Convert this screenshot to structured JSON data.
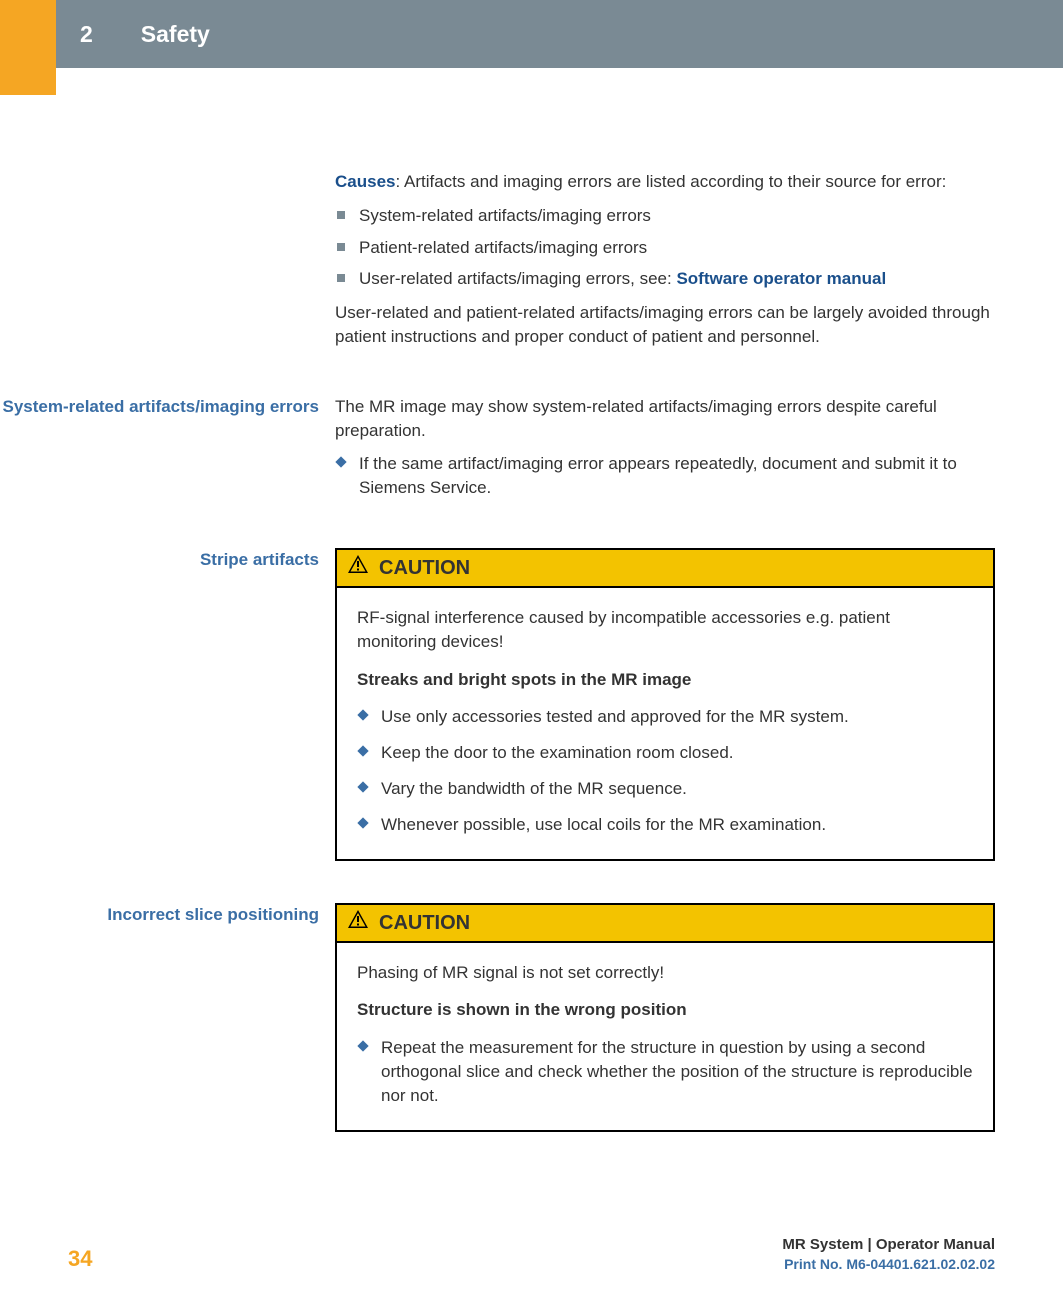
{
  "header": {
    "chapter_num": "2",
    "chapter_title": "Safety"
  },
  "intro": {
    "causes_label": "Causes",
    "causes_text": ": Artifacts and imaging errors are listed according to their source for error:",
    "bullets": [
      "System-related artifacts/imaging errors",
      "Patient-related artifacts/imaging errors"
    ],
    "bullet3_pre": "User-related artifacts/imaging errors, see: ",
    "bullet3_link": "Software operator manual",
    "after": "User-related and patient-related artifacts/imaging errors can be largely avoided through patient instructions and proper conduct of patient and personnel."
  },
  "section1": {
    "label": "System-related artifacts/imaging errors",
    "text": "The MR image may show system-related artifacts/imaging errors despite careful preparation.",
    "action": "If the same artifact/imaging error appears repeatedly, document and submit it to Siemens Service."
  },
  "section2": {
    "label": "Stripe artifacts",
    "caution_label": "CAUTION",
    "body1": "RF-signal interference caused by incompatible accessories e.g. patient monitoring devices!",
    "body_bold": "Streaks and bright spots in the MR image",
    "items": [
      "Use only accessories tested and approved for the MR system.",
      "Keep the door to the examination room closed.",
      "Vary the bandwidth of the MR sequence.",
      "Whenever possible, use local coils for the MR examination."
    ]
  },
  "section3": {
    "label": "Incorrect slice positioning",
    "caution_label": "CAUTION",
    "body1": "Phasing of MR signal is not set correctly!",
    "body_bold": "Structure is shown in the wrong position",
    "items": [
      "Repeat the measurement for the structure in question by using a second orthogonal slice and check whether the position of the structure is reproducible nor not."
    ]
  },
  "footer": {
    "page": "34",
    "manual": "MR System | Operator Manual",
    "print": "Print No. M6-04401.621.02.02.02"
  }
}
